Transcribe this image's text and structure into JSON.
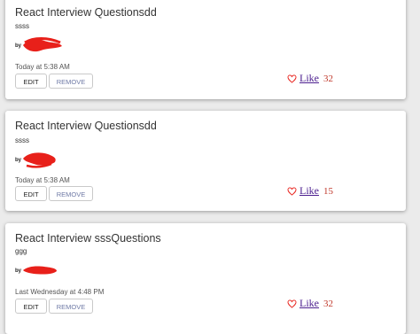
{
  "posts": [
    {
      "title": "React Interview Questionsdd",
      "body": "ssss",
      "author_prefix": "by",
      "time": "Today at 5:38 AM",
      "edit_label": "EDIT",
      "remove_label": "REMOVE",
      "like_label": "Like",
      "like_count": "32"
    },
    {
      "title": "React Interview Questionsdd",
      "body": "ssss",
      "author_prefix": "by",
      "time": "Today at 5:38 AM",
      "edit_label": "EDIT",
      "remove_label": "REMOVE",
      "like_label": "Like",
      "like_count": "15"
    },
    {
      "title": "React Interview sssQuestions",
      "body": "ggg",
      "author_prefix": "by",
      "time": "Last Wednesday at 4:48 PM",
      "edit_label": "EDIT",
      "remove_label": "REMOVE",
      "like_label": "Like",
      "like_count": "32"
    }
  ],
  "colors": {
    "accent_red": "#e8201a",
    "link_purple": "#4c1f8f",
    "remove_text": "#6f7aa6"
  }
}
